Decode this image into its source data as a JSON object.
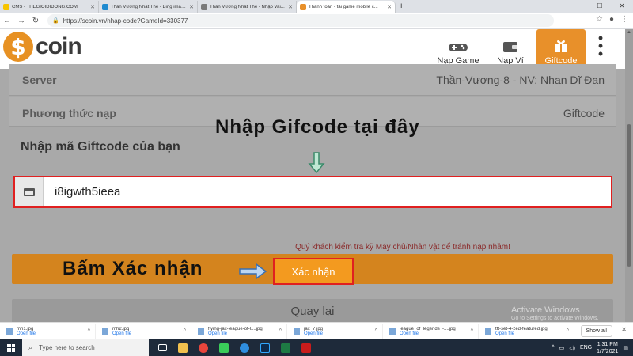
{
  "browser": {
    "tabs": [
      {
        "title": "CMS - THEGIOIDIDONG.COM",
        "favicon_color": "#f7c400"
      },
      {
        "title": "Thần Vương Nhất Thế - Bing images",
        "favicon_color": "#1f8bd0"
      },
      {
        "title": "Thần Vương Nhất Thế - Nhập Vai...",
        "favicon_color": "#7a7a7a"
      },
      {
        "title": "Thanh toán - tải game mobile c...",
        "favicon_color": "#e8902a"
      }
    ],
    "new_tab": "+",
    "url": "https://scoin.vn/nhap-code?GameId=330377"
  },
  "header": {
    "logo_symbol": "$",
    "logo_text": "coin",
    "nav": [
      {
        "label": "Nạp Game",
        "icon": "gamepad-icon"
      },
      {
        "label": "Nạp Ví",
        "icon": "wallet-icon"
      },
      {
        "label": "Giftcode",
        "icon": "gift-icon"
      }
    ]
  },
  "info": {
    "server_label": "Server",
    "server_value": "Thần-Vương-8 - NV: Nhan Dĩ Đan",
    "method_label": "Phương thức nạp",
    "method_value": "Giftcode"
  },
  "form": {
    "title": "Nhập mã Giftcode của bạn",
    "code_value": "i8igwth5ieea",
    "warning": "Quý khách kiểm tra kỹ Máy chủ/Nhân vật để tránh nạp nhầm!",
    "submit_label": "Xác nhận",
    "back_label": "Quay lại"
  },
  "annotations": {
    "enter_code": "Nhập Gifcode tại đây",
    "press_confirm": "Bấm Xác nhận"
  },
  "watermark": {
    "title": "Activate Windows",
    "subtitle": "Go to Settings to activate Windows."
  },
  "downloads": {
    "items": [
      {
        "name": "mh1.jpg",
        "action": "Open file"
      },
      {
        "name": "mh2.jpg",
        "action": "Open file"
      },
      {
        "name": "flying-jax-league-of-l....jpg",
        "action": "Open file"
      },
      {
        "name": "jax_7.jpg",
        "action": "Open file"
      },
      {
        "name": "league_of_legends_-....jpg",
        "action": "Open file"
      },
      {
        "name": "tft-set-4-zed-featured.jpg",
        "action": "Open file"
      }
    ],
    "show_all": "Show all"
  },
  "taskbar": {
    "search_placeholder": "Type here to search",
    "lang": "ENG",
    "time": "1:31 PM",
    "date": "1/7/2021"
  },
  "colors": {
    "accent": "#e8902a",
    "highlight": "#e02020"
  }
}
